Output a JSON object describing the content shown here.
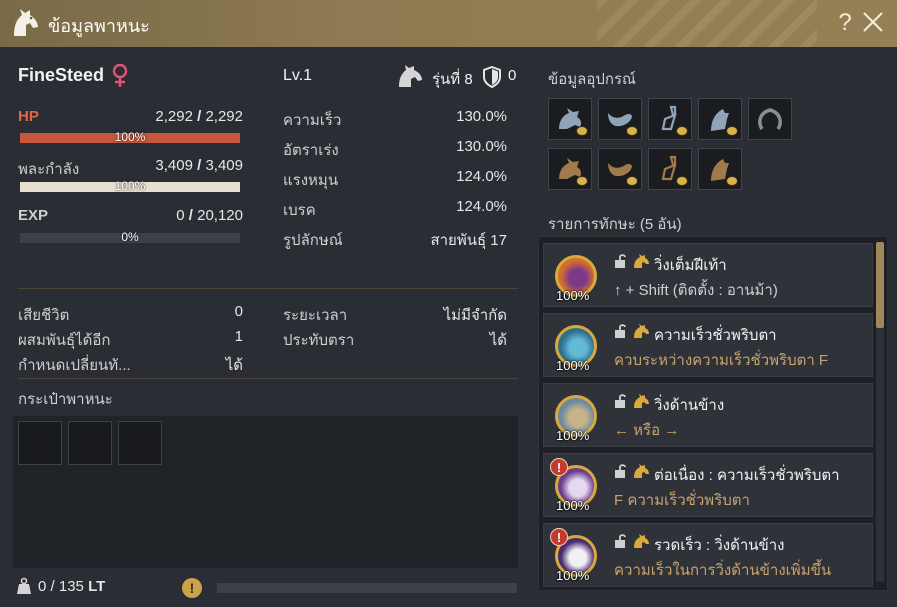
{
  "window": {
    "title": "ข้อมูลพาหนะ",
    "help": "?"
  },
  "horse": {
    "name": "FineSteed",
    "level": "Lv.1",
    "generation": "รุ่นที่ 8",
    "shield_count": "0",
    "stats": [
      {
        "label": "HP",
        "value": "2,292",
        "max": "2,292",
        "pct": "100%",
        "fill": 1.0,
        "color": "#e0654a",
        "bar_color": "#c8553c"
      },
      {
        "label": "พละกำลัง",
        "value": "3,409",
        "max": "3,409",
        "pct": "100%",
        "fill": 1.0,
        "color": "#cfcfcf",
        "bar_color": "#e8e0cf"
      },
      {
        "label": "EXP",
        "value": "0",
        "max": "20,120",
        "pct": "0%",
        "fill": 0.0,
        "color": "#cfcfcf",
        "bar_color": "#e8e0cf"
      }
    ],
    "attributes": [
      {
        "label": "ความเร็ว",
        "value": "130.0%"
      },
      {
        "label": "อัตราเร่ง",
        "value": "130.0%"
      },
      {
        "label": "แรงหมุน",
        "value": "124.0%"
      },
      {
        "label": "เบรค",
        "value": "124.0%"
      },
      {
        "label": "รูปลักษณ์",
        "value": "สายพันธุ์ 17"
      }
    ],
    "info_left": [
      {
        "label": "เสียชีวิต",
        "value": "0"
      },
      {
        "label": "ผสมพันธุ์ได้อีก",
        "value": "1"
      },
      {
        "label": "กำหนดเปลี่ยนทั...",
        "value": "ได้"
      }
    ],
    "info_right": [
      {
        "label": "ระยะเวลา",
        "value": "ไม่มีจำกัด"
      },
      {
        "label": "ประทับตรา",
        "value": "ได้"
      }
    ]
  },
  "inventory": {
    "title": "กระเป๋าพาหนะ",
    "weight_current": "0",
    "weight_max": "135",
    "weight_unit": "LT",
    "warn_symbol": "!"
  },
  "equipment": {
    "title": "ข้อมูลอุปกรณ์",
    "row1": [
      "horse-armor-icon",
      "saddle-icon",
      "stirrups-icon",
      "horse-helmet-icon",
      "horseshoe-icon"
    ],
    "row2": [
      "horse-armor-icon",
      "saddle-icon",
      "stirrups-icon",
      "horse-helmet-icon"
    ]
  },
  "skills": {
    "title": "รายการทักษะ (5 อัน)",
    "items": [
      {
        "name": "วิ่งเต็มฝีเท้า",
        "cmd": "↑ + Shift (ติดตั้ง : อานม้า)",
        "cmd_color": "#cfcfcf",
        "pct": "100%",
        "warn": false,
        "icon_bg": "#d46e2c",
        "icon_fg": "#7a3a88"
      },
      {
        "name": "ความเร็วชั่วพริบตา",
        "cmd": "ควบระหว่างความเร็วชั่วพริบตา F",
        "cmd_color": "#c9a46a",
        "pct": "100%",
        "warn": false,
        "icon_bg": "#2f6f8a",
        "icon_fg": "#62b9d8"
      },
      {
        "name": "วิ่งด้านข้าง",
        "cmd": "← หรือ →",
        "cmd_color": "#c9a46a",
        "pct": "100%",
        "warn": false,
        "icon_bg": "#6a8aa0",
        "icon_fg": "#c7b48a"
      },
      {
        "name": "ต่อเนื่อง : ความเร็วชั่วพริบตา",
        "cmd": "F ความเร็วชั่วพริบตา",
        "cmd_color": "#c9a46a",
        "pct": "100%",
        "warn": true,
        "warn_symbol": "!",
        "icon_bg": "#6b3e8c",
        "icon_fg": "#e6d8f0"
      },
      {
        "name": "รวดเร็ว : วิ่งด้านข้าง",
        "cmd": "ความเร็วในการวิ่งด้านข้างเพิ่มขึ้น",
        "cmd_color": "#c9a46a",
        "pct": "100%",
        "warn": true,
        "warn_symbol": "!",
        "icon_bg": "#4a2a70",
        "icon_fg": "#f0f0f5"
      }
    ]
  }
}
